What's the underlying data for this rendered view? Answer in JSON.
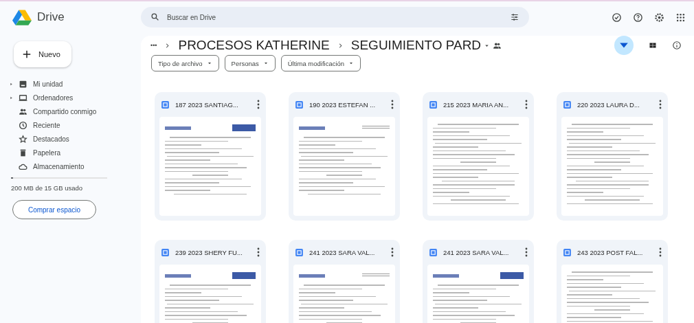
{
  "app": {
    "title": "Drive"
  },
  "new_button": {
    "label": "Nuevo"
  },
  "sidebar": {
    "items": [
      {
        "label": "Mi unidad",
        "expandable": true,
        "selected": false
      },
      {
        "label": "Ordenadores",
        "expandable": true,
        "selected": false
      },
      {
        "label": "Compartido conmigo",
        "expandable": false,
        "selected": false
      },
      {
        "label": "Reciente",
        "expandable": false,
        "selected": false
      },
      {
        "label": "Destacados",
        "expandable": false,
        "selected": false
      },
      {
        "label": "Papelera",
        "expandable": false,
        "selected": false
      },
      {
        "label": "Almacenamiento",
        "expandable": false,
        "selected": false
      }
    ],
    "storage": {
      "level": 0.02,
      "text": "200 MB de 15 GB usado"
    },
    "buy_button": {
      "label": "Comprar espacio"
    }
  },
  "search": {
    "placeholder": "Buscar en Drive"
  },
  "breadcrumb": {
    "more": "•••",
    "items": [
      "PROCESOS KATHERINE",
      "SEGUIMIENTO PARD"
    ]
  },
  "filters": [
    {
      "label": "Tipo de archivo"
    },
    {
      "label": "Personas"
    },
    {
      "label": "Última modificación"
    }
  ],
  "files": [
    {
      "name": "187 2023 SANTIAG...",
      "kind": "branded"
    },
    {
      "name": "190 2023 ESTEFAN ...",
      "kind": "letterhead"
    },
    {
      "name": "215 2023 MARIA AN...",
      "kind": "text"
    },
    {
      "name": "220 2023 LAURA D...",
      "kind": "text"
    },
    {
      "name": "239 2023 SHERY FU...",
      "kind": "branded"
    },
    {
      "name": "241 2023 SARA VAL...",
      "kind": "letterhead"
    },
    {
      "name": "241 2023 SARA VAL...",
      "kind": "branded"
    },
    {
      "name": "243 2023 POST FAL...",
      "kind": "text"
    }
  ]
}
